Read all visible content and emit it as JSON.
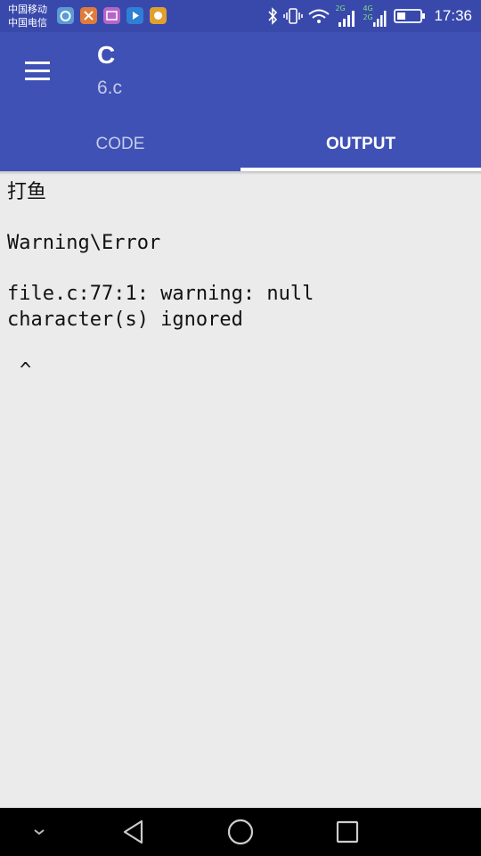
{
  "status_bar": {
    "carrier_1": "中国移动",
    "carrier_2": "中国电信",
    "network_1": "2G",
    "network_2_top": "4G",
    "network_2_bottom": "2G",
    "time": "17:36"
  },
  "app_bar": {
    "title": "C",
    "subtitle": "6.c",
    "menu_icon": "hamburger-menu-icon"
  },
  "tabs": [
    {
      "label": "CODE",
      "active": false
    },
    {
      "label": "OUTPUT",
      "active": true
    }
  ],
  "output": {
    "program_output": "打鱼",
    "section_header": "Warning\\Error",
    "warning_line_1": "file.c:77:1: warning: null",
    "warning_line_2": "character(s) ignored",
    "caret": "^"
  },
  "colors": {
    "status_bar": "#3949ab",
    "app_bar": "#3f51b5",
    "background": "#ebebeb"
  }
}
